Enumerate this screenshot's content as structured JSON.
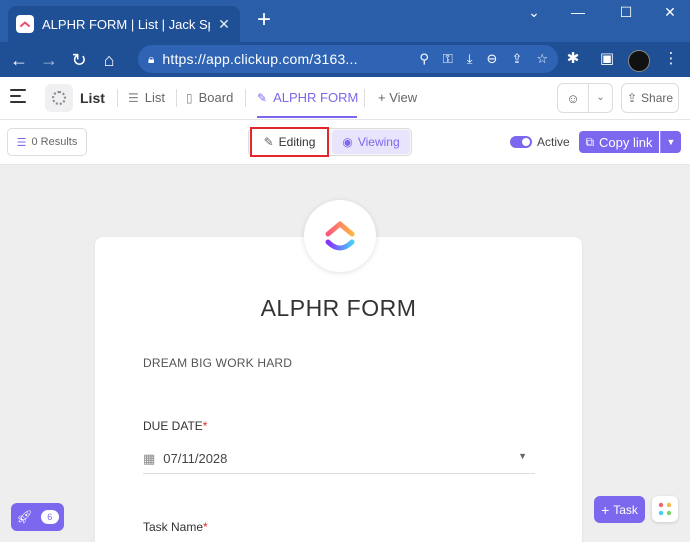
{
  "browser": {
    "tab_title": "ALPHR FORM | List | Jack Sparrow",
    "tab_close": "✕",
    "new_tab": "+",
    "url": "https://app.clickup.com/3163...",
    "window_controls": {
      "minimize": "—",
      "maximize": "☐",
      "close": "✕"
    }
  },
  "header": {
    "title": "List",
    "views": [
      {
        "label": "List",
        "icon": "list-icon"
      },
      {
        "label": "Board",
        "icon": "board-icon"
      },
      {
        "label": "ALPHR FORM",
        "icon": "form-icon",
        "active": true
      }
    ],
    "add_view_label": "+ View",
    "share_label": "Share"
  },
  "toolbar": {
    "results_label": "0 Results",
    "editing_label": "Editing",
    "viewing_label": "Viewing",
    "active_label": "Active",
    "active_toggle_on": true,
    "copy_link_label": "Copy link"
  },
  "form": {
    "title": "ALPHR FORM",
    "description": "DREAM BIG WORK HARD",
    "fields": [
      {
        "label": "DUE DATE",
        "required": "*",
        "value": "07/11/2028"
      },
      {
        "label": "Task Name",
        "required": "*"
      }
    ]
  },
  "floating": {
    "rocket_badge": "6",
    "task_label": "Task"
  },
  "colors": {
    "accent": "#7b68ee",
    "highlight_box": "#e3262b",
    "browser_chrome": "#1f4f95"
  }
}
